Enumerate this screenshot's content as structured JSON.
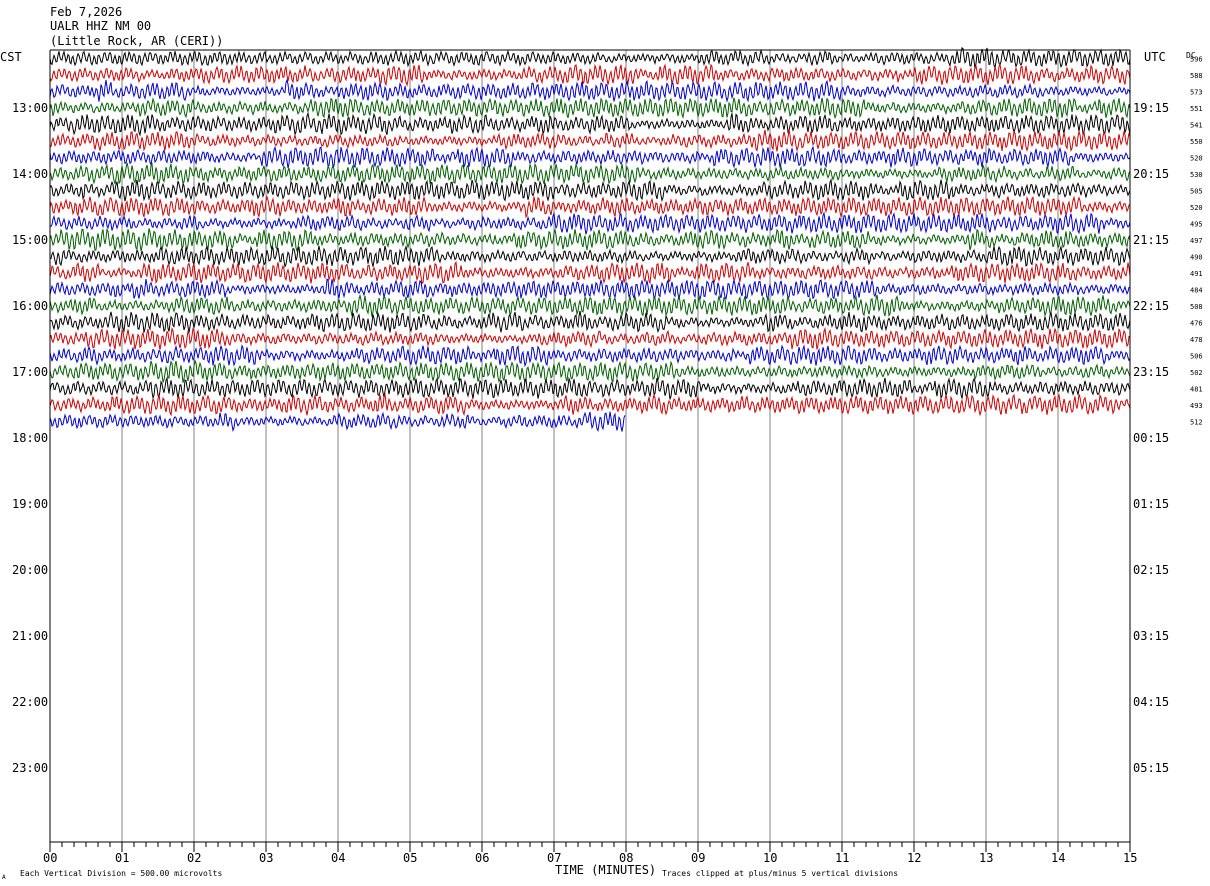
{
  "header": {
    "date": "Feb 7,2026",
    "station": "UALR HHZ NM 00",
    "location": "(Little Rock, AR (CERI))"
  },
  "axes": {
    "left_tz": "CST",
    "right_tz": "UTC",
    "dc_label": "DC",
    "left_hour_labels": [
      "13:00",
      "14:00",
      "15:00",
      "16:00",
      "17:00",
      "18:00",
      "19:00",
      "20:00",
      "21:00",
      "22:00",
      "23:00"
    ],
    "right_hour_labels": [
      "19:15",
      "20:15",
      "21:15",
      "22:15",
      "23:15",
      "00:15",
      "01:15",
      "02:15",
      "03:15",
      "04:15",
      "05:15"
    ],
    "x_tick_labels": [
      "00",
      "01",
      "02",
      "03",
      "04",
      "05",
      "06",
      "07",
      "08",
      "09",
      "10",
      "11",
      "12",
      "13",
      "14",
      "15"
    ],
    "xlabel": "TIME (MINUTES)"
  },
  "footer": {
    "vertical_division": "Each Vertical Division =  500.00 microvolts",
    "clipping_note": "Traces clipped at plus/minus 5 vertical divisions",
    "corner_mark": "A"
  },
  "colors": {
    "trace_cycle": [
      "#000000",
      "#d00000",
      "#0000d0",
      "#006000"
    ],
    "grid": "#808080",
    "text": "#000000"
  },
  "chart_data": {
    "type": "line",
    "subtype": "helicorder",
    "x_range_minutes": [
      0,
      15
    ],
    "row_interval_minutes": 15,
    "rows_total": 48,
    "first_row_time_cst": "12:15",
    "traces": [
      {
        "start_cst": "12:15",
        "dc": 596,
        "fraction_recorded": 1.0
      },
      {
        "start_cst": "12:30",
        "dc": 588,
        "fraction_recorded": 1.0
      },
      {
        "start_cst": "12:45",
        "dc": 573,
        "fraction_recorded": 1.0
      },
      {
        "start_cst": "13:00",
        "dc": 551,
        "fraction_recorded": 1.0
      },
      {
        "start_cst": "13:15",
        "dc": 541,
        "fraction_recorded": 1.0
      },
      {
        "start_cst": "13:30",
        "dc": 550,
        "fraction_recorded": 1.0
      },
      {
        "start_cst": "13:45",
        "dc": 520,
        "fraction_recorded": 1.0
      },
      {
        "start_cst": "14:00",
        "dc": 530,
        "fraction_recorded": 1.0
      },
      {
        "start_cst": "14:15",
        "dc": 505,
        "fraction_recorded": 1.0
      },
      {
        "start_cst": "14:30",
        "dc": 520,
        "fraction_recorded": 1.0
      },
      {
        "start_cst": "14:45",
        "dc": 495,
        "fraction_recorded": 1.0
      },
      {
        "start_cst": "15:00",
        "dc": 497,
        "fraction_recorded": 1.0
      },
      {
        "start_cst": "15:15",
        "dc": 490,
        "fraction_recorded": 1.0
      },
      {
        "start_cst": "15:30",
        "dc": 491,
        "fraction_recorded": 1.0
      },
      {
        "start_cst": "15:45",
        "dc": 484,
        "fraction_recorded": 1.0
      },
      {
        "start_cst": "16:00",
        "dc": 508,
        "fraction_recorded": 1.0
      },
      {
        "start_cst": "16:15",
        "dc": 476,
        "fraction_recorded": 1.0
      },
      {
        "start_cst": "16:30",
        "dc": 478,
        "fraction_recorded": 1.0
      },
      {
        "start_cst": "16:45",
        "dc": 506,
        "fraction_recorded": 1.0
      },
      {
        "start_cst": "17:00",
        "dc": 502,
        "fraction_recorded": 1.0
      },
      {
        "start_cst": "17:15",
        "dc": 481,
        "fraction_recorded": 1.0
      },
      {
        "start_cst": "17:30",
        "dc": 493,
        "fraction_recorded": 1.0
      },
      {
        "start_cst": "17:45",
        "dc": 512,
        "fraction_recorded": 0.533
      }
    ]
  }
}
